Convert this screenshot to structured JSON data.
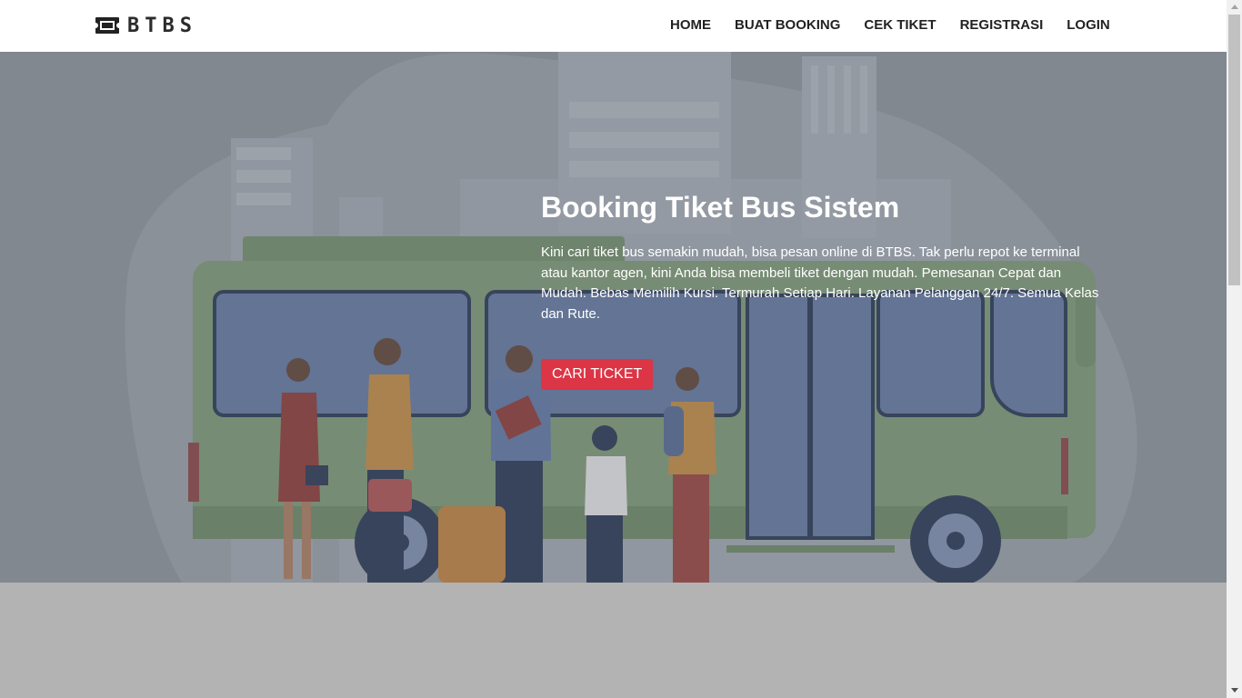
{
  "navbar": {
    "brand": "BTBS",
    "brand_icon": "ticket-icon",
    "links": [
      "HOME",
      "BUAT BOOKING",
      "CEK TIKET",
      "REGISTRASI",
      "LOGIN"
    ]
  },
  "hero": {
    "title": "Booking Tiket Bus Sistem",
    "description": "Kini cari tiket bus semakin mudah, bisa pesan online di BTBS. Tak perlu repot ke terminal atau kantor agen, kini Anda bisa membeli tiket dengan mudah. Pemesanan Cepat dan Mudah. Bebas Memilih Kursi. Termurah Setiap Hari. Layanan Pelanggan 24/7. Semua Kelas dan Rute.",
    "cta_label": "CARI TICKET"
  },
  "colors": {
    "cta": "#dc3545",
    "overlay": "#8e949c",
    "bus": "#7d9a70"
  }
}
